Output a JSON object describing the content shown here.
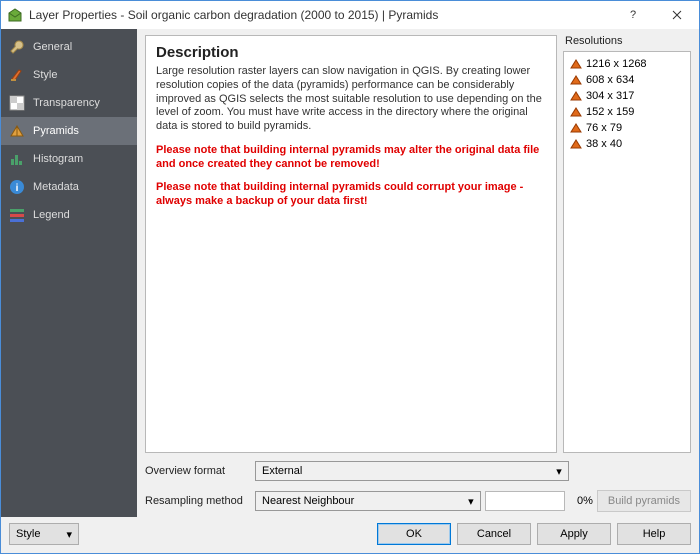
{
  "titlebar": {
    "title": "Layer Properties - Soil organic carbon degradation (2000 to 2015) | Pyramids",
    "help": "?",
    "close": "🞩"
  },
  "sidebar": {
    "items": [
      {
        "label": "General",
        "icon": "wrench"
      },
      {
        "label": "Style",
        "icon": "brush"
      },
      {
        "label": "Transparency",
        "icon": "checker"
      },
      {
        "label": "Pyramids",
        "icon": "pyramid",
        "active": true
      },
      {
        "label": "Histogram",
        "icon": "histogram"
      },
      {
        "label": "Metadata",
        "icon": "info"
      },
      {
        "label": "Legend",
        "icon": "legend"
      }
    ]
  },
  "description": {
    "heading": "Description",
    "body": "Large resolution raster layers can slow navigation in QGIS. By creating lower resolution copies of the data (pyramids) performance can be considerably improved as QGIS selects the most suitable resolution to use depending on the level of zoom. You must have write access in the directory where the original data is stored to build pyramids.",
    "warn1": "Please note that building internal pyramids may alter the original data file and once created they cannot be removed!",
    "warn2": "Please note that building internal pyramids could corrupt your image - always make a backup of your data first!"
  },
  "resolutions": {
    "label": "Resolutions",
    "items": [
      "1216 x 1268",
      "608 x 634",
      "304 x 317",
      "152 x 159",
      "76 x 79",
      "38 x 40"
    ]
  },
  "overview": {
    "label": "Overview format",
    "value": "External"
  },
  "resampling": {
    "label": "Resampling method",
    "value": "Nearest Neighbour"
  },
  "progress": {
    "percent": "0%"
  },
  "buttons": {
    "build": "Build pyramids",
    "style": "Style",
    "ok": "OK",
    "cancel": "Cancel",
    "apply": "Apply",
    "help": "Help"
  }
}
